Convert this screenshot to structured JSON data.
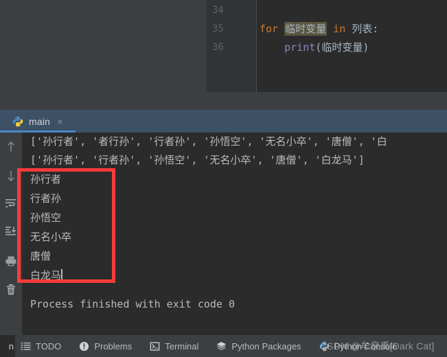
{
  "editor": {
    "line_numbers": [
      "34",
      "35",
      "36"
    ],
    "code": {
      "line35": {
        "keyword_for": "for",
        "highlighted_var": "临时变量",
        "keyword_in": "in",
        "iterable": "列表:"
      },
      "line36": {
        "func": "print",
        "open_paren": "(",
        "arg": "临时变量",
        "close_paren": ")"
      }
    }
  },
  "tab_bar": {
    "tabs": [
      {
        "label": "main",
        "icon": "python-file-icon",
        "close_label": "×",
        "active": true
      }
    ]
  },
  "run_toolbar": {
    "buttons": [
      {
        "name": "scroll-up-icon",
        "title": "Up"
      },
      {
        "name": "scroll-down-icon",
        "title": "Down"
      },
      {
        "name": "soft-wrap-icon",
        "title": "Soft-Wrap"
      },
      {
        "name": "scroll-to-end-icon",
        "title": "Scroll to End"
      },
      {
        "name": "print-icon",
        "title": "Print"
      },
      {
        "name": "trash-icon",
        "title": "Clear All"
      }
    ]
  },
  "console": {
    "top_lines": [
      "['孙行者', '者行孙', '行者孙', '孙悟空', '无名小卒', '唐僧', '白",
      "['孙行者', '行者孙', '孙悟空', '无名小卒', '唐僧', '白龙马']"
    ],
    "loop_output": [
      "孙行者",
      "行者孙",
      "孙悟空",
      "无名小卒",
      "唐僧",
      "白龙马"
    ],
    "finish_line": "Process finished with exit code 0"
  },
  "annotation": {
    "highlight_color": "#f93b3b"
  },
  "bottom_bar": {
    "run_tab_stub_label": "n",
    "items": [
      {
        "label": "TODO",
        "icon": "list-icon"
      },
      {
        "label": "Problems",
        "icon": "warning-circle-icon"
      },
      {
        "label": "Terminal",
        "icon": "terminal-icon"
      },
      {
        "label": "Python Packages",
        "icon": "layers-icon"
      },
      {
        "label": "Python Console",
        "icon": "python-icon"
      }
    ],
    "watermark": "CSDN @牟泉禹[Dark Cat]"
  }
}
